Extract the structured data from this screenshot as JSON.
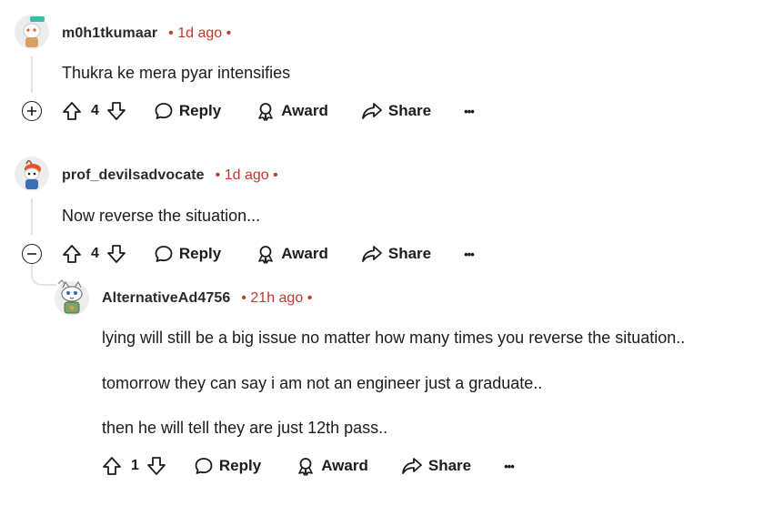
{
  "comments": [
    {
      "username": "m0h1tkumaar",
      "time": "1d ago",
      "dot": "•",
      "body": [
        "Thukra ke mera pyar intensifies"
      ],
      "votes": "4",
      "actions": {
        "reply": "Reply",
        "award": "Award",
        "share": "Share",
        "more": "•••"
      }
    },
    {
      "username": "prof_devilsadvocate",
      "time": "1d ago",
      "dot": "•",
      "body": [
        "Now reverse the situation..."
      ],
      "votes": "4",
      "actions": {
        "reply": "Reply",
        "award": "Award",
        "share": "Share",
        "more": "•••"
      }
    },
    {
      "username": "AlternativeAd4756",
      "time": "21h ago",
      "dot": "•",
      "body": [
        "lying will still be a big issue no matter how many times you reverse the situation..",
        "tomorrow they can say i am not an engineer just a graduate..",
        "then he will tell they are just 12th pass.."
      ],
      "votes": "1",
      "actions": {
        "reply": "Reply",
        "award": "Award",
        "share": "Share",
        "more": "•••"
      }
    }
  ],
  "colors": {
    "meta": "#c0392b",
    "text": "#1c1c1c",
    "thread": "#e3e3e3"
  },
  "icons": [
    "upvote-icon",
    "downvote-icon",
    "reply-bubble-icon",
    "award-icon",
    "share-arrow-icon",
    "expand-plus-icon",
    "collapse-minus-icon"
  ]
}
